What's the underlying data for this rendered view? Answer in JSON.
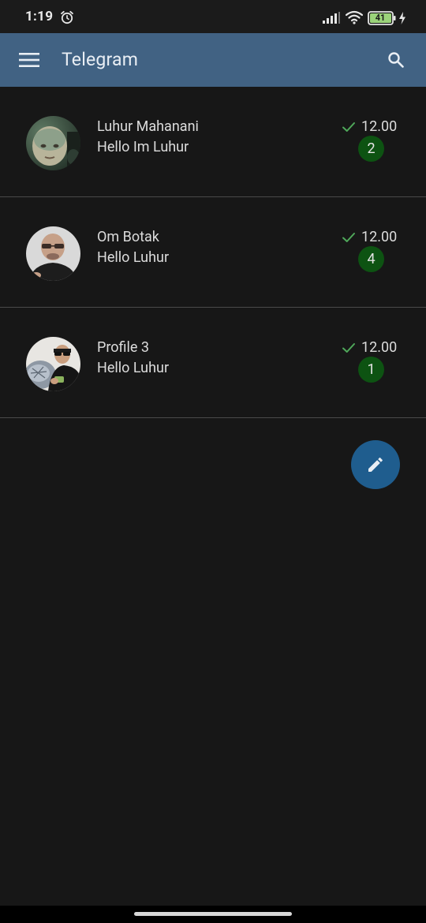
{
  "status_bar": {
    "time": "1:19",
    "battery": "41",
    "icons": [
      "alarm-icon",
      "signal-icon",
      "wifi-icon",
      "battery-icon",
      "charging-bolt-icon"
    ]
  },
  "header": {
    "title": "Telegram",
    "menu_icon": "hamburger-menu-icon",
    "search_icon": "search-icon",
    "background_color": "#416283"
  },
  "chats": [
    {
      "name": "Luhur Mahanani",
      "message": "Hello Im Luhur",
      "time": "12.00",
      "unread": "2",
      "avatar_icon": "child-photo-avatar"
    },
    {
      "name": "Om Botak",
      "message": "Hello Luhur",
      "time": "12.00",
      "unread": "4",
      "avatar_icon": "bald-man-photo-avatar"
    },
    {
      "name": "Profile 3",
      "message": "Hello Luhur",
      "time": "12.00",
      "unread": "1",
      "avatar_icon": "man-sunglasses-photo-avatar"
    }
  ],
  "fab": {
    "icon": "pencil-icon",
    "color": "#1f5d8e"
  },
  "colors": {
    "background": "#171717",
    "badge": "#0d5312",
    "check": "#4fa85a"
  }
}
